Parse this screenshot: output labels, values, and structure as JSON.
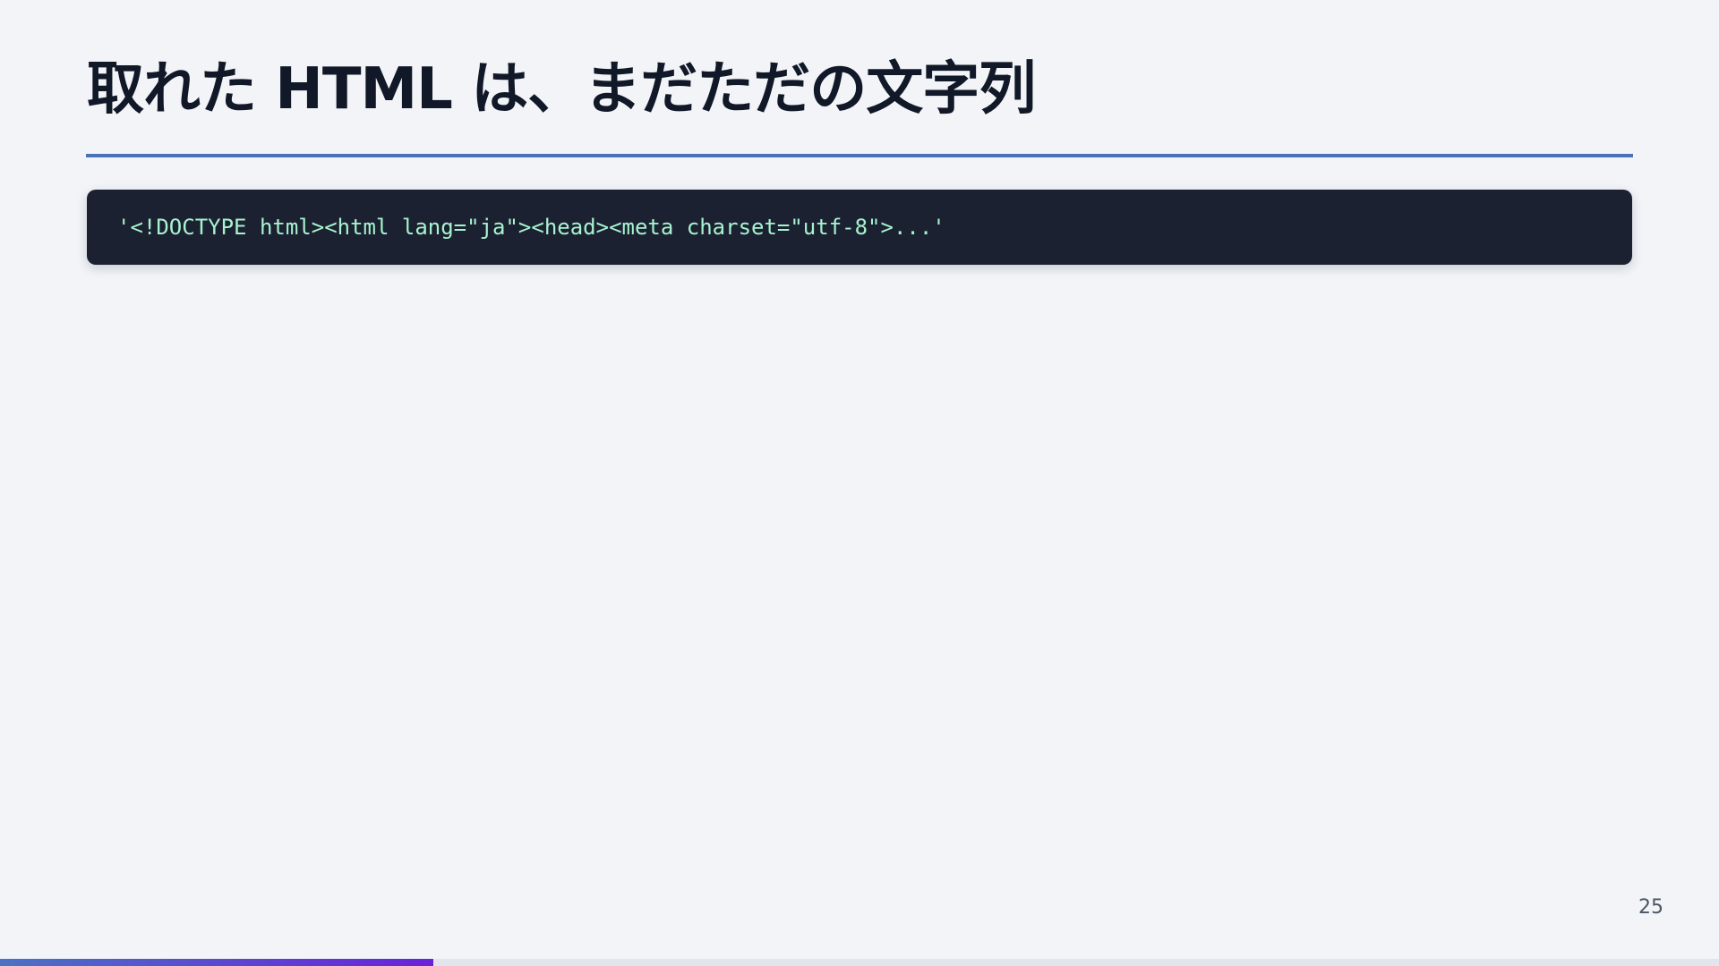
{
  "slide": {
    "title": "取れた HTML は、まだただの文字列",
    "code": "'<!DOCTYPE html><html lang=\"ja\"><head><meta charset=\"utf-8\">...'",
    "page_number": "25"
  },
  "progress": {
    "fraction": 0.252
  },
  "colors": {
    "background": "#f2f4f8",
    "title_text": "#111827",
    "accent_rule": "#4a72b8",
    "code_background": "#1b2130",
    "code_text": "#a7f3d0",
    "progress_start": "#4a72c4",
    "progress_end": "#6a22d8"
  }
}
